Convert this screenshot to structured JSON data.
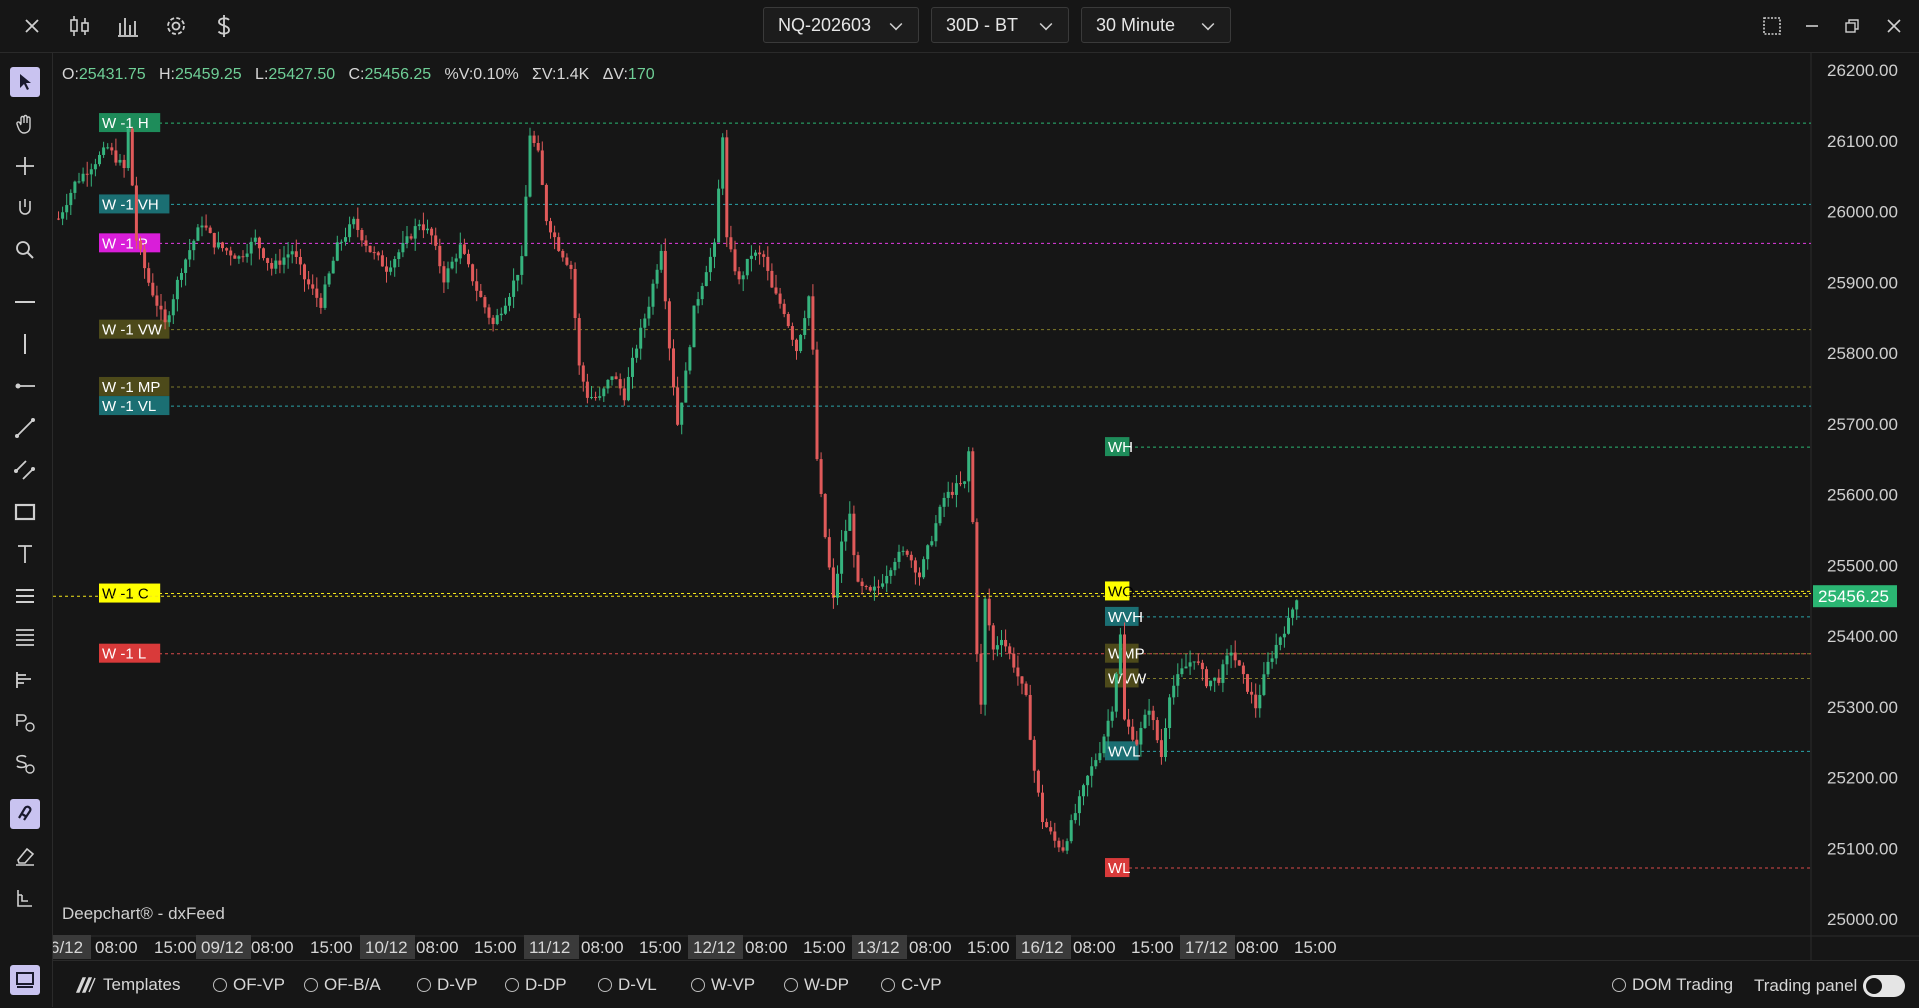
{
  "toolbar": {
    "close_icon": "close-icon",
    "symbol": "NQ-202603",
    "period": "30D - BT",
    "timeframe": "30 Minute"
  },
  "ohlc": {
    "o_label": "O:",
    "o": "25431.75",
    "h_label": "H:",
    "h": "25459.25",
    "l_label": "L:",
    "l": "25427.50",
    "c_label": "C:",
    "c": "25456.25",
    "pv_label": "%V:",
    "pv": "0.10%",
    "sv_label": "ΣV:",
    "sv": "1.4K",
    "dv_label": "ΔV:",
    "dv": "170"
  },
  "credit": "Deepchart® - dxFeed",
  "price_axis": {
    "ticks": [
      "26200.00",
      "26100.00",
      "26000.00",
      "25900.00",
      "25800.00",
      "25700.00",
      "25600.00",
      "25500.00",
      "25400.00",
      "25300.00",
      "25200.00",
      "25100.00",
      "25000.00"
    ],
    "tick_values": [
      26200,
      26100,
      26000,
      25900,
      25800,
      25700,
      25600,
      25500,
      25400,
      25300,
      25200,
      25100,
      25000
    ],
    "last_price": "25456.25"
  },
  "time_axis": {
    "labels": [
      "6/12",
      "08:00",
      "15:00",
      "09/12",
      "08:00",
      "15:00",
      "10/12",
      "08:00",
      "15:00",
      "11/12",
      "08:00",
      "15:00",
      "12/12",
      "08:00",
      "15:00",
      "13/12",
      "08:00",
      "15:00",
      "16/12",
      "08:00",
      "15:00",
      "17/12",
      "08:00",
      "15:00"
    ],
    "day_labels": [
      "6/12",
      "09/12",
      "10/12",
      "11/12",
      "12/12",
      "13/12",
      "16/12",
      "17/12"
    ]
  },
  "levels": [
    {
      "label": "W -1 H",
      "price": 26125,
      "color": "#1e8c5a",
      "line": "#2bb673",
      "side": "prev",
      "text_color": "#ffffff"
    },
    {
      "label": "W -1 VH",
      "price": 26010,
      "color": "#1b6f73",
      "line": "#2aa3a8",
      "side": "prev",
      "text_color": "#ffffff"
    },
    {
      "label": "W -1 P",
      "price": 25955,
      "color": "#d91ed9",
      "line": "#e23be2",
      "side": "prev",
      "text_color": "#ffffff"
    },
    {
      "label": "W -1 VW",
      "price": 25833,
      "color": "#4d4a1a",
      "line": "#7f7a2a",
      "side": "prev",
      "text_color": "#ffffff"
    },
    {
      "label": "W -1 MP",
      "price": 25752,
      "color": "#4d4a1a",
      "line": "#7f7a2a",
      "side": "prev",
      "text_color": "#ffffff"
    },
    {
      "label": "W -1 VL",
      "price": 25725,
      "color": "#1b6f73",
      "line": "#2aa3a8",
      "side": "prev",
      "text_color": "#ffffff"
    },
    {
      "label": "W -1 C",
      "price": 25460,
      "color": "#ffff00",
      "line": "#f2e51a",
      "side": "prev",
      "text_color": "#000000"
    },
    {
      "label": "W -1 L",
      "price": 25375,
      "color": "#d93a3a",
      "line": "#d94a4a",
      "side": "prev",
      "text_color": "#ffffff"
    },
    {
      "label": "WH",
      "price": 25667,
      "color": "#1e8c5a",
      "line": "#2bb673",
      "side": "cur",
      "text_color": "#ffffff"
    },
    {
      "label": "WO",
      "price": 25463,
      "color": "#ffff00",
      "line": "#f2e51a",
      "side": "cur",
      "text_color": "#000000"
    },
    {
      "label": "WVH",
      "price": 25427,
      "color": "#1b6f73",
      "line": "#2aa3a8",
      "side": "cur",
      "text_color": "#ffffff"
    },
    {
      "label": "WMP",
      "price": 25375,
      "color": "#4d4a1a",
      "line": "#7f7a2a",
      "side": "cur",
      "text_color": "#ffffff"
    },
    {
      "label": "WVW",
      "price": 25340,
      "color": "#4d4a1a",
      "line": "#7f7a2a",
      "side": "cur",
      "text_color": "#ffffff"
    },
    {
      "label": "WVL",
      "price": 25237,
      "color": "#1b6f73",
      "line": "#2aa3a8",
      "side": "cur",
      "text_color": "#ffffff"
    },
    {
      "label": "WL",
      "price": 25072,
      "color": "#d93a3a",
      "line": "#d94a4a",
      "side": "cur",
      "text_color": "#ffffff"
    }
  ],
  "price_path": [
    [
      0,
      25990
    ],
    [
      4,
      26040
    ],
    [
      8,
      26065
    ],
    [
      12,
      26090
    ],
    [
      16,
      26060
    ],
    [
      17,
      26115
    ],
    [
      19,
      25960
    ],
    [
      22,
      25900
    ],
    [
      26,
      25840
    ],
    [
      30,
      25920
    ],
    [
      35,
      25985
    ],
    [
      38,
      25955
    ],
    [
      44,
      25935
    ],
    [
      48,
      25960
    ],
    [
      52,
      25920
    ],
    [
      57,
      25945
    ],
    [
      60,
      25905
    ],
    [
      64,
      25870
    ],
    [
      68,
      25950
    ],
    [
      72,
      25985
    ],
    [
      76,
      25945
    ],
    [
      80,
      25920
    ],
    [
      84,
      25950
    ],
    [
      88,
      25985
    ],
    [
      91,
      25965
    ],
    [
      94,
      25905
    ],
    [
      98,
      25950
    ],
    [
      102,
      25890
    ],
    [
      106,
      25840
    ],
    [
      110,
      25885
    ],
    [
      113,
      25930
    ],
    [
      115,
      26110
    ],
    [
      117,
      26080
    ],
    [
      119,
      25990
    ],
    [
      122,
      25950
    ],
    [
      125,
      25920
    ],
    [
      127,
      25780
    ],
    [
      129,
      25740
    ],
    [
      132,
      25735
    ],
    [
      135,
      25770
    ],
    [
      138,
      25740
    ],
    [
      141,
      25810
    ],
    [
      144,
      25870
    ],
    [
      147,
      25950
    ],
    [
      149,
      25810
    ],
    [
      151,
      25700
    ],
    [
      153,
      25770
    ],
    [
      155,
      25860
    ],
    [
      158,
      25920
    ],
    [
      160,
      25950
    ],
    [
      162,
      26110
    ],
    [
      163,
      25960
    ],
    [
      166,
      25900
    ],
    [
      169,
      25940
    ],
    [
      172,
      25935
    ],
    [
      174,
      25890
    ],
    [
      177,
      25860
    ],
    [
      180,
      25805
    ],
    [
      183,
      25880
    ],
    [
      184,
      25800
    ],
    [
      185,
      25650
    ],
    [
      187,
      25540
    ],
    [
      189,
      25450
    ],
    [
      191,
      25530
    ],
    [
      193,
      25570
    ],
    [
      195,
      25470
    ],
    [
      198,
      25460
    ],
    [
      200,
      25470
    ],
    [
      204,
      25510
    ],
    [
      207,
      25520
    ],
    [
      210,
      25485
    ],
    [
      213,
      25540
    ],
    [
      216,
      25595
    ],
    [
      219,
      25610
    ],
    [
      221,
      25615
    ],
    [
      222,
      25660
    ],
    [
      223,
      25560
    ],
    [
      224,
      25380
    ],
    [
      225,
      25300
    ],
    [
      226,
      25450
    ],
    [
      228,
      25380
    ],
    [
      230,
      25400
    ],
    [
      233,
      25360
    ],
    [
      236,
      25310
    ],
    [
      238,
      25210
    ],
    [
      240,
      25140
    ],
    [
      243,
      25110
    ],
    [
      245,
      25100
    ],
    [
      248,
      25150
    ],
    [
      251,
      25200
    ],
    [
      254,
      25240
    ],
    [
      257,
      25300
    ],
    [
      259,
      25400
    ],
    [
      260,
      25280
    ],
    [
      263,
      25250
    ],
    [
      266,
      25300
    ],
    [
      269,
      25230
    ],
    [
      271,
      25320
    ],
    [
      274,
      25350
    ],
    [
      277,
      25370
    ],
    [
      280,
      25335
    ],
    [
      283,
      25340
    ],
    [
      286,
      25380
    ],
    [
      289,
      25340
    ],
    [
      292,
      25300
    ],
    [
      295,
      25360
    ],
    [
      298,
      25400
    ],
    [
      300,
      25420
    ],
    [
      302,
      25456
    ]
  ]
}
